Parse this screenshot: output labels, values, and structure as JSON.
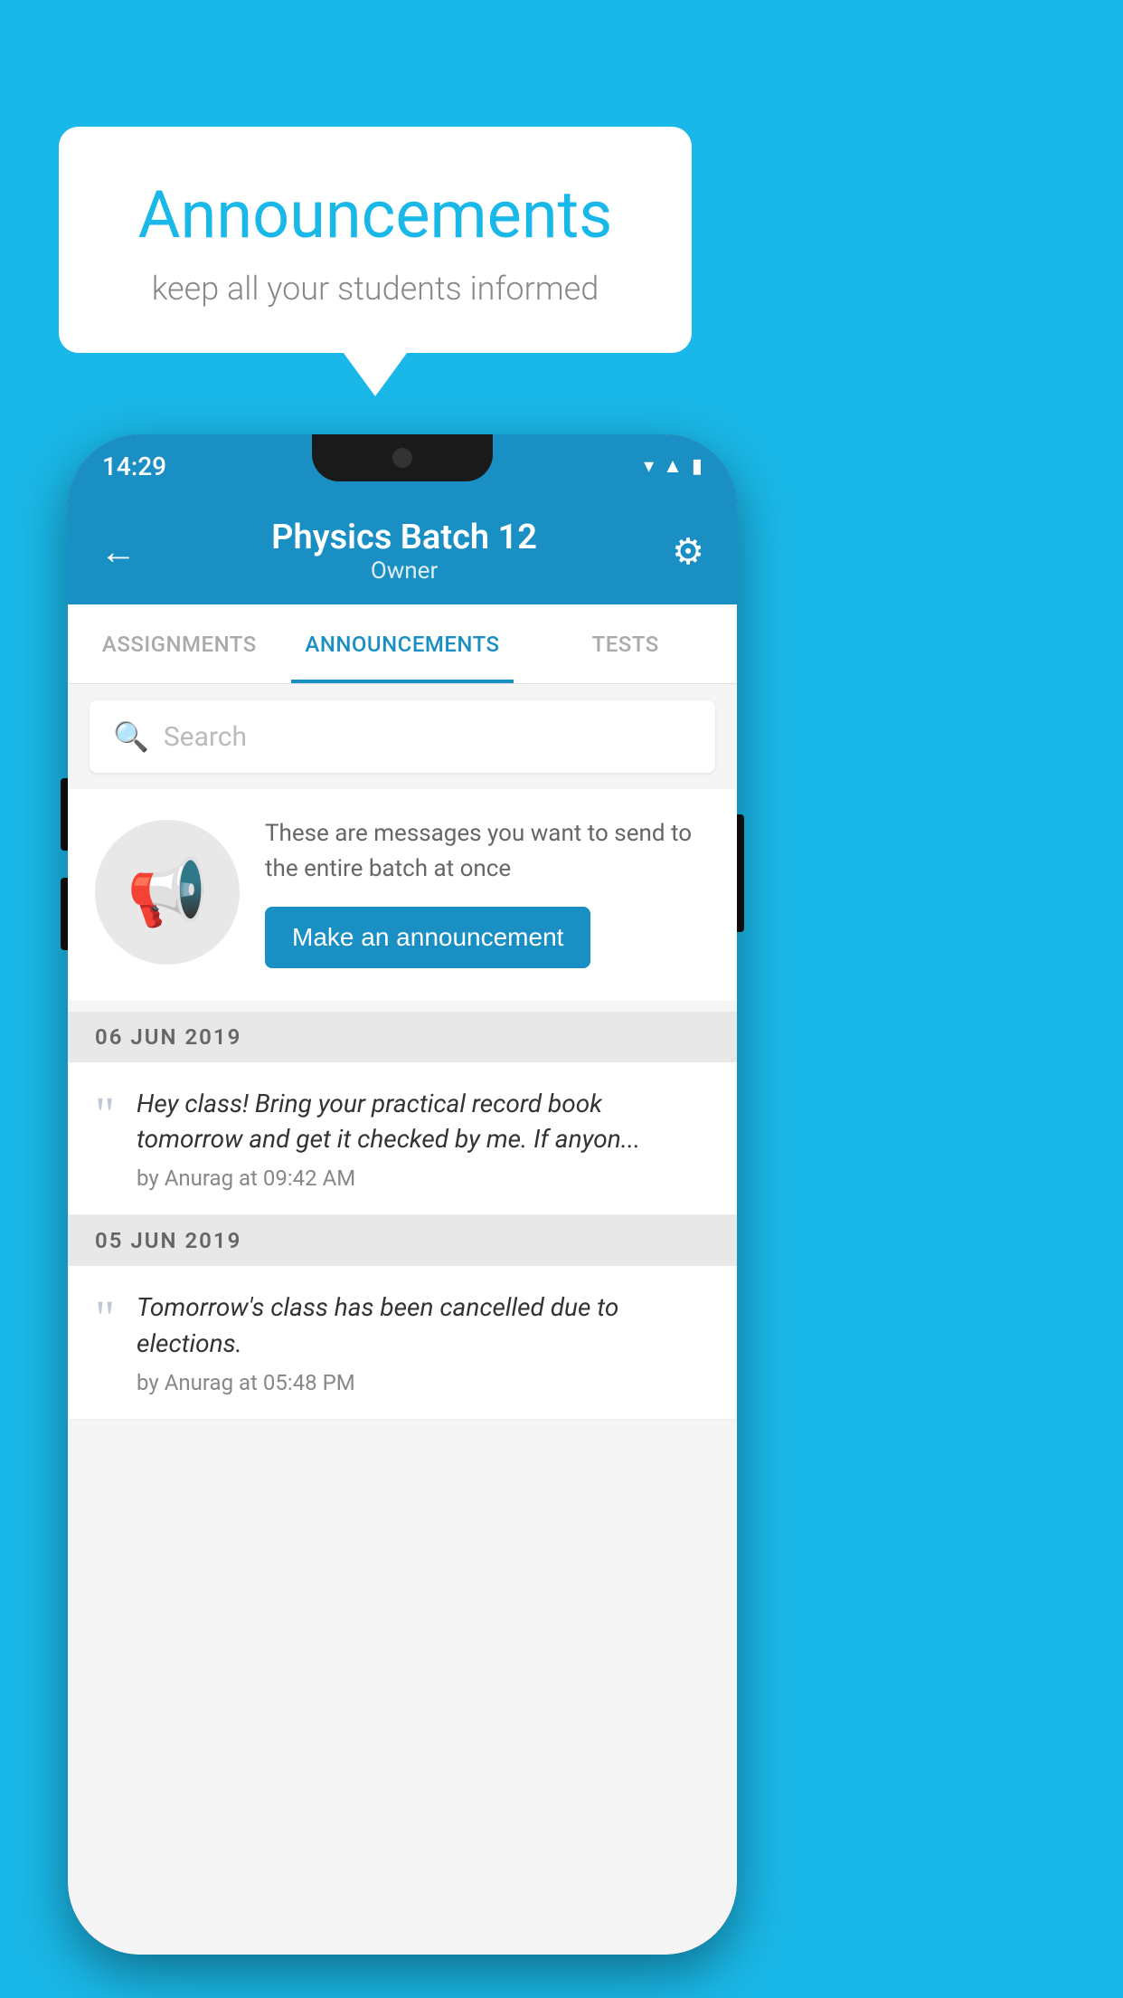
{
  "background": {
    "color": "#1ab8e8"
  },
  "speech_bubble": {
    "title": "Announcements",
    "subtitle": "keep all your students informed"
  },
  "phone": {
    "status_bar": {
      "time": "14:29"
    },
    "header": {
      "title": "Physics Batch 12",
      "subtitle": "Owner",
      "back_label": "←",
      "gear_label": "⚙"
    },
    "tabs": [
      {
        "label": "ASSIGNMENTS",
        "active": false
      },
      {
        "label": "ANNOUNCEMENTS",
        "active": true
      },
      {
        "label": "TESTS",
        "active": false
      }
    ],
    "search": {
      "placeholder": "Search"
    },
    "promo": {
      "description": "These are messages you want to send to the entire batch at once",
      "button_label": "Make an announcement"
    },
    "announcements": [
      {
        "date": "06  JUN  2019",
        "text": "Hey class! Bring your practical record book tomorrow and get it checked by me. If anyon...",
        "meta": "by Anurag at 09:42 AM"
      },
      {
        "date": "05  JUN  2019",
        "text": "Tomorrow's class has been cancelled due to elections.",
        "meta": "by Anurag at 05:48 PM"
      }
    ]
  }
}
